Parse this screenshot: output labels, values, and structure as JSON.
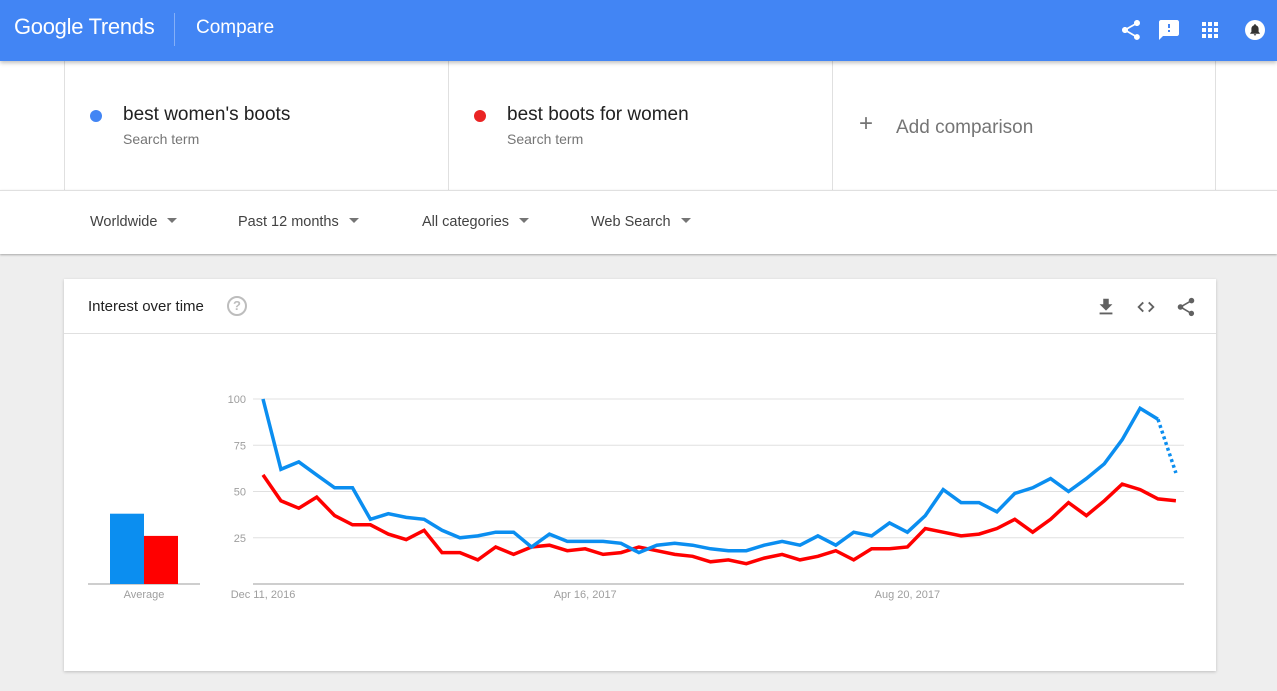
{
  "header": {
    "logo_google": "Google",
    "logo_trends": "Trends",
    "page_title": "Compare",
    "icons": [
      "share-icon",
      "feedback-icon",
      "apps-icon",
      "notifications-icon"
    ]
  },
  "terms": [
    {
      "name": "best women's boots",
      "subtitle": "Search term",
      "color": "#4285f4"
    },
    {
      "name": "best boots for women",
      "subtitle": "Search term",
      "color": "#ea2424"
    }
  ],
  "add_comparison": {
    "icon": "+",
    "label": "Add comparison"
  },
  "filters": [
    {
      "label": "Worldwide"
    },
    {
      "label": "Past 12 months"
    },
    {
      "label": "All categories"
    },
    {
      "label": "Web Search"
    }
  ],
  "card": {
    "title": "Interest over time",
    "help_icon": "?",
    "actions": [
      "download-icon",
      "embed-icon",
      "share-icon"
    ]
  },
  "colors": {
    "series1": "#0b8ef0",
    "series2": "#ff0000",
    "appbar": "#4285f4"
  },
  "chart_data": {
    "type": "line",
    "title": "Interest over time",
    "x_start": "Dec 11, 2016",
    "x_interval": "weekly",
    "x_tick_labels": [
      {
        "label": "Dec 11, 2016",
        "index": 0
      },
      {
        "label": "Apr 16, 2017",
        "index": 18
      },
      {
        "label": "Aug 20, 2017",
        "index": 36
      }
    ],
    "y_ticks": [
      25,
      50,
      75,
      100
    ],
    "ylim": [
      0,
      100
    ],
    "grid": true,
    "average_label": "Average",
    "series": [
      {
        "name": "best women's boots",
        "color": "#0b8ef0",
        "average": 38,
        "partial_last_point": true,
        "values": [
          100,
          62,
          66,
          59,
          52,
          52,
          35,
          38,
          36,
          35,
          29,
          25,
          26,
          28,
          28,
          20,
          27,
          23,
          23,
          23,
          22,
          17,
          21,
          22,
          21,
          19,
          18,
          18,
          21,
          23,
          21,
          26,
          21,
          28,
          26,
          33,
          28,
          37,
          51,
          44,
          44,
          39,
          49,
          52,
          57,
          50,
          57,
          65,
          78,
          95,
          89,
          60
        ]
      },
      {
        "name": "best boots for women",
        "color": "#ff0000",
        "average": 26,
        "partial_last_point": false,
        "values": [
          59,
          45,
          41,
          47,
          37,
          32,
          32,
          27,
          24,
          29,
          17,
          17,
          13,
          20,
          16,
          20,
          21,
          18,
          19,
          16,
          17,
          20,
          18,
          16,
          15,
          12,
          13,
          11,
          14,
          16,
          13,
          15,
          18,
          13,
          19,
          19,
          20,
          30,
          28,
          26,
          27,
          30,
          35,
          28,
          35,
          44,
          37,
          45,
          54,
          51,
          46,
          45
        ]
      }
    ]
  }
}
